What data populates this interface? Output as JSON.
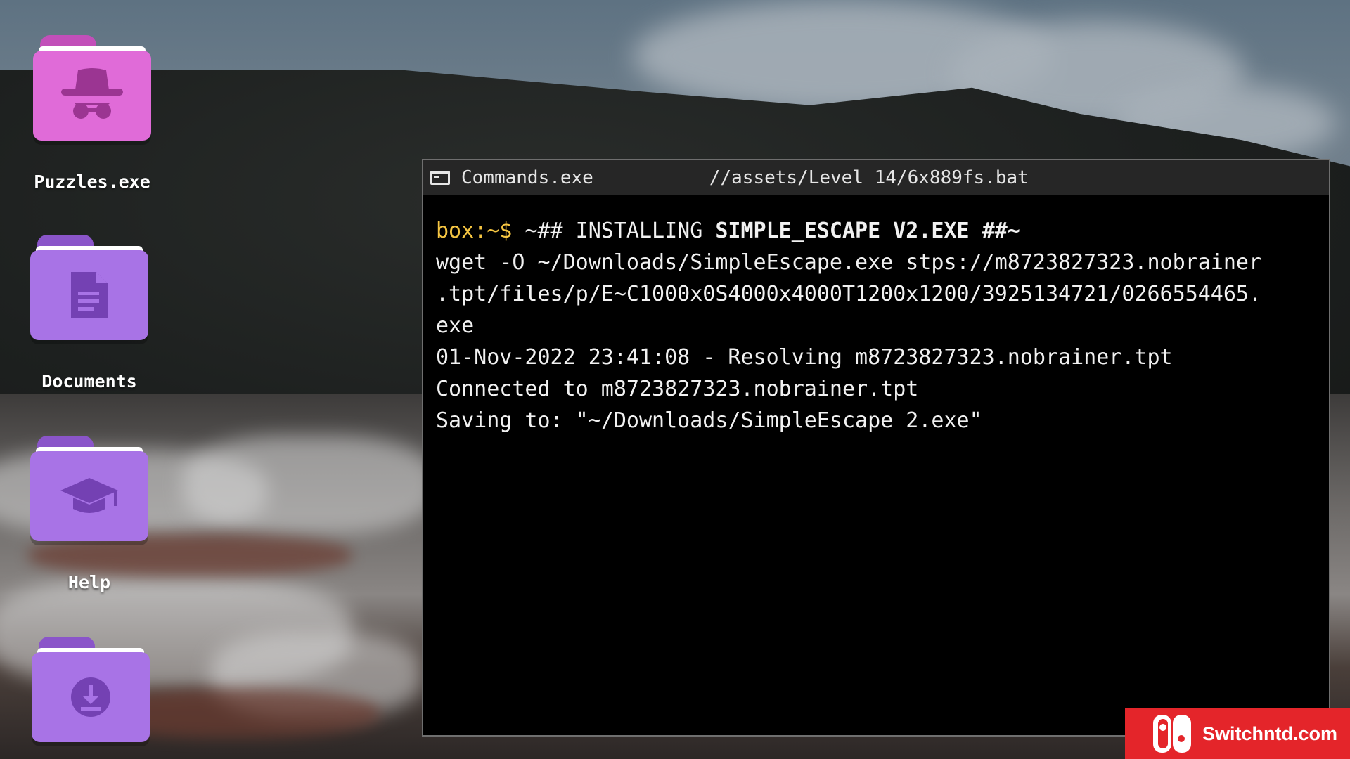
{
  "desktop": {
    "icons": [
      {
        "label": "Puzzles.exe",
        "icon": "detective-icon",
        "color": "#e06bd8"
      },
      {
        "label": "Documents",
        "icon": "document-icon",
        "color": "#a873e6"
      },
      {
        "label": "Help",
        "icon": "graduation-cap-icon",
        "color": "#a873e6"
      },
      {
        "label": "",
        "icon": "download-icon",
        "color": "#a873e6"
      }
    ]
  },
  "terminal": {
    "title": "Commands.exe",
    "path": "//assets/Level 14/6x889fs.bat",
    "prompt": "box:~$",
    "command_prefix": " ~## INSTALLING ",
    "command_bold": "SIMPLE_ESCAPE V2.EXE ##~",
    "lines": [
      "wget -O ~/Downloads/SimpleEscape.exe stps://m8723827323.nobrainer",
      ".tpt/files/p/E~C1000x0S4000x4000T1200x1200/3925134721/0266554465.",
      "exe",
      "01-Nov-2022 23:41:08 - Resolving m8723827323.nobrainer.tpt",
      "Connected to m8723827323.nobrainer.tpt",
      "Saving to: \"~/Downloads/SimpleEscape 2.exe\""
    ]
  },
  "watermark": {
    "text": "Switchntd.com",
    "color": "#e4252a"
  },
  "colors": {
    "prompt": "#f5c542",
    "terminal_bg": "#000000",
    "titlebar_bg": "#262626"
  }
}
